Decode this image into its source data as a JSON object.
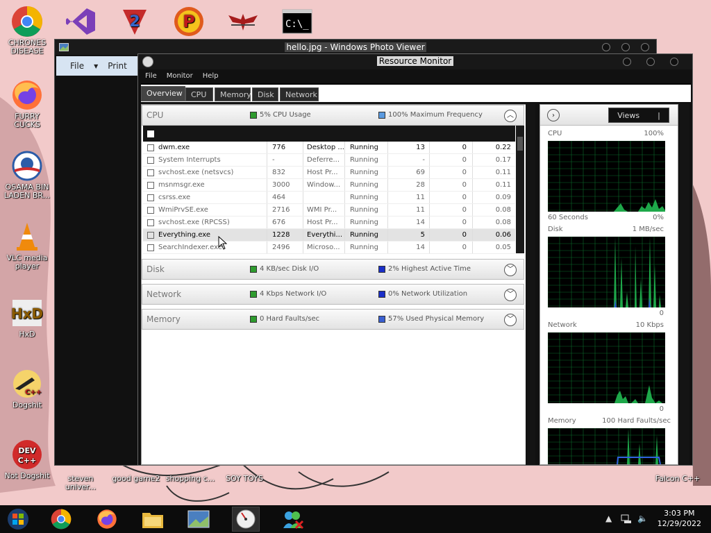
{
  "desktop": {
    "icons": [
      {
        "label": "CHRONES DISEASE",
        "icon": "chrome-icon"
      },
      {
        "label": "",
        "icon": "visual-studio-icon"
      },
      {
        "label": "",
        "icon": "ravenfield-icon"
      },
      {
        "label": "",
        "icon": "pepsi-p-icon"
      },
      {
        "label": "",
        "icon": "arstotzka-eagle-icon"
      },
      {
        "label": "",
        "icon": "command-prompt-icon"
      },
      {
        "label": "FURRY CUCKS",
        "icon": "firefox-icon"
      },
      {
        "label": "OSAMA BIN LADEN BR...",
        "icon": "obama-logo-icon"
      },
      {
        "label": "VLC media player",
        "icon": "vlc-cone-icon"
      },
      {
        "label": "HxD",
        "icon": "hxd-icon"
      },
      {
        "label": "Dogshit",
        "icon": "codeblocks-icon"
      },
      {
        "label": "Not Dogshit",
        "icon": "dev-cpp-icon"
      }
    ],
    "bottom_labels": [
      "steven univer...",
      "good game2",
      "shopping c...",
      "SOY TOYS",
      "Falcon C++"
    ],
    "dev_cpp_text": "DEV C++"
  },
  "photo_viewer": {
    "title": "hello.jpg - Windows Photo Viewer",
    "menu": {
      "file": "File",
      "print": "Print"
    }
  },
  "resource_monitor": {
    "title": "Resource Monitor",
    "menubar": [
      "File",
      "Monitor",
      "Help"
    ],
    "tabs": [
      "Overview",
      "CPU",
      "Memory",
      "Disk",
      "Network"
    ],
    "active_tab": "Overview",
    "sections": {
      "cpu": {
        "name": "CPU",
        "stat1": "5% CPU Usage",
        "stat2": "100% Maximum Frequency",
        "stat1_color": "#2e9b2e",
        "stat2_color": "#5a9ae0"
      },
      "disk": {
        "name": "Disk",
        "stat1": "4 KB/sec Disk I/O",
        "stat2": "2% Highest Active Time",
        "stat1_color": "#2e9b2e",
        "stat2_color": "#1a2fc8"
      },
      "network": {
        "name": "Network",
        "stat1": "4 Kbps Network I/O",
        "stat2": "0% Network Utilization",
        "stat1_color": "#2e9b2e",
        "stat2_color": "#1a2fc8"
      },
      "memory": {
        "name": "Memory",
        "stat1": "0 Hard Faults/sec",
        "stat2": "57% Used Physical Memory",
        "stat1_color": "#2e9b2e",
        "stat2_color": "#3a5fd0"
      }
    },
    "processes": [
      {
        "image": "dwm.exe",
        "pid": "776",
        "desc": "Desktop ...",
        "status": "Running",
        "threads": "13",
        "cpu": "0",
        "avg": "0.22"
      },
      {
        "image": "System Interrupts",
        "pid": "-",
        "desc": "Deferre...",
        "status": "Running",
        "threads": "-",
        "cpu": "0",
        "avg": "0.17"
      },
      {
        "image": "svchost.exe (netsvcs)",
        "pid": "832",
        "desc": "Host Pr...",
        "status": "Running",
        "threads": "69",
        "cpu": "0",
        "avg": "0.11"
      },
      {
        "image": "msnmsgr.exe",
        "pid": "3000",
        "desc": "Window...",
        "status": "Running",
        "threads": "28",
        "cpu": "0",
        "avg": "0.11"
      },
      {
        "image": "csrss.exe",
        "pid": "464",
        "desc": "",
        "status": "Running",
        "threads": "11",
        "cpu": "0",
        "avg": "0.09"
      },
      {
        "image": "WmiPrvSE.exe",
        "pid": "2716",
        "desc": "WMI Pr...",
        "status": "Running",
        "threads": "11",
        "cpu": "0",
        "avg": "0.08"
      },
      {
        "image": "svchost.exe (RPCSS)",
        "pid": "676",
        "desc": "Host Pr...",
        "status": "Running",
        "threads": "14",
        "cpu": "0",
        "avg": "0.08"
      },
      {
        "image": "Everything.exe",
        "pid": "1228",
        "desc": "Everythi...",
        "status": "Running",
        "threads": "5",
        "cpu": "0",
        "avg": "0.06"
      },
      {
        "image": "SearchIndexer.exe",
        "pid": "2496",
        "desc": "Microso...",
        "status": "Running",
        "threads": "14",
        "cpu": "0",
        "avg": "0.05"
      }
    ],
    "selected_process": "Everything.exe",
    "views_label": "Views",
    "graphs": [
      {
        "name": "CPU",
        "max": "100%",
        "footer_left": "60 Seconds",
        "footer_right": "0%"
      },
      {
        "name": "Disk",
        "max": "1 MB/sec",
        "footer_left": "",
        "footer_right": "0"
      },
      {
        "name": "Network",
        "max": "10 Kbps",
        "footer_left": "",
        "footer_right": "0"
      },
      {
        "name": "Memory",
        "max": "100 Hard Faults/sec",
        "footer_left": "",
        "footer_right": ""
      }
    ]
  },
  "taskbar": {
    "items": [
      "start-orb-icon",
      "chrome-icon",
      "firefox-icon",
      "file-explorer-icon",
      "photo-viewer-icon",
      "resource-monitor-icon",
      "network-users-icon"
    ],
    "active": "resource-monitor-icon",
    "time": "3:03 PM",
    "date": "12/29/2022"
  }
}
